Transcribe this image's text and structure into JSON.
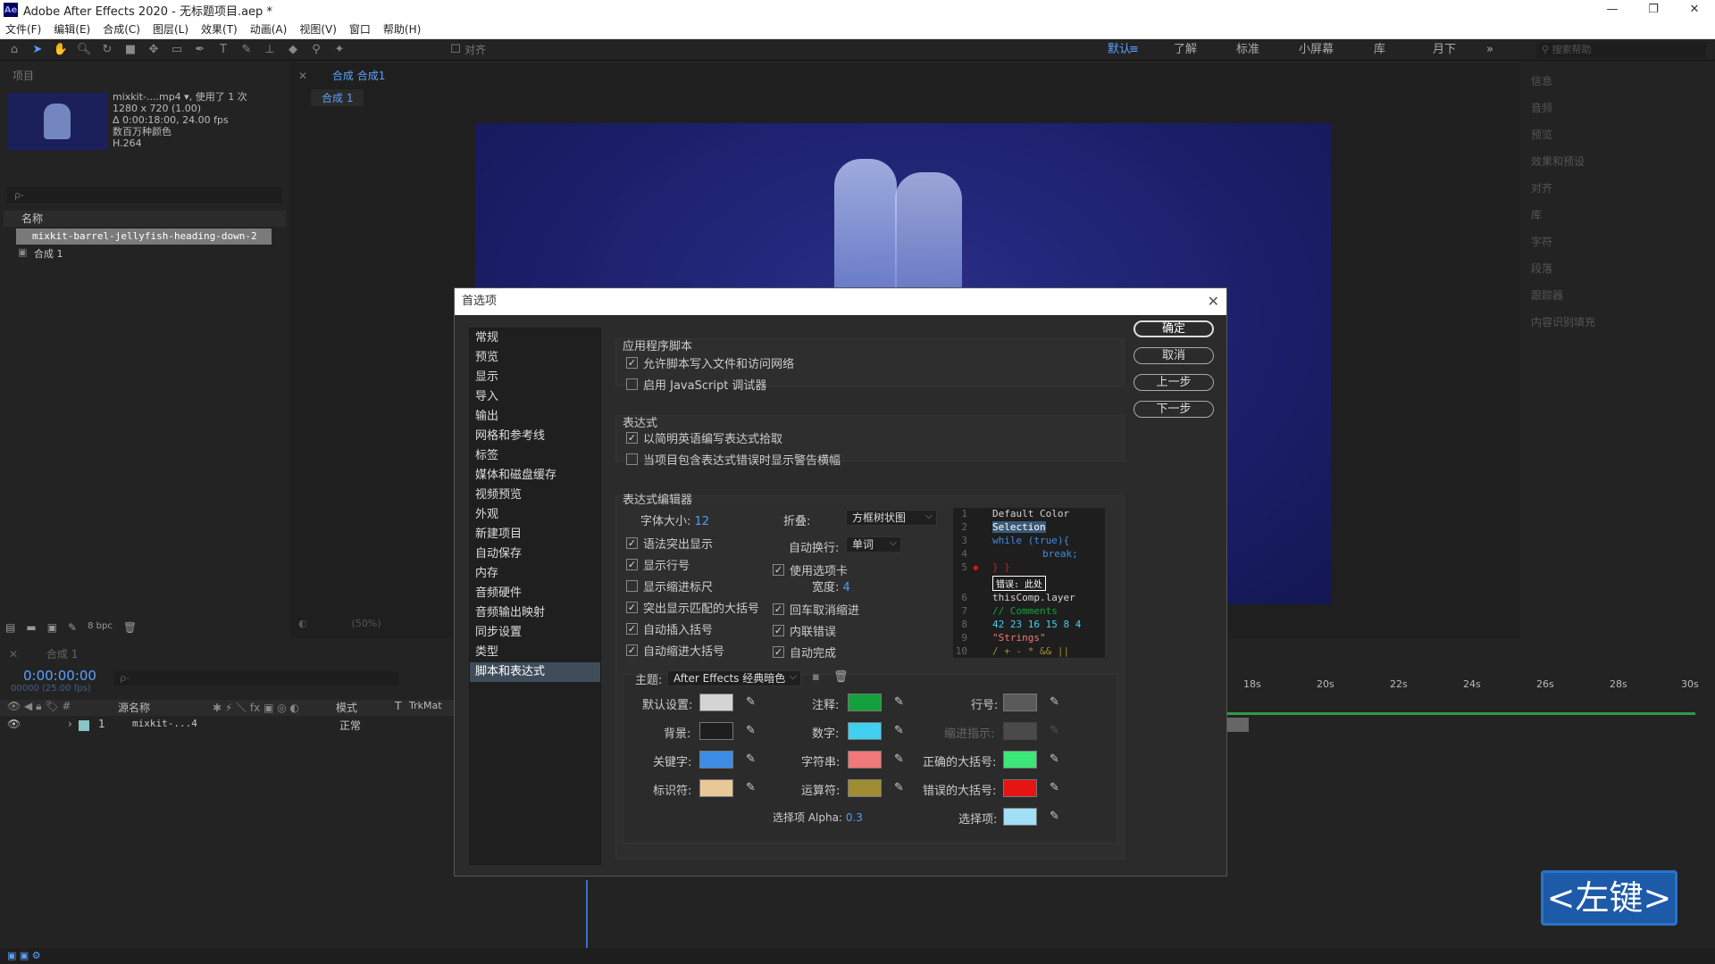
{
  "window": {
    "title": "Adobe After Effects 2020 - 无标题项目.aep *",
    "logo": "Ae",
    "controls": [
      "—",
      "❐",
      "✕"
    ]
  },
  "menu": [
    "文件(F)",
    "编辑(E)",
    "合成(C)",
    "图层(L)",
    "效果(T)",
    "动画(A)",
    "视图(V)",
    "窗口",
    "帮助(H)"
  ],
  "toolbar": {
    "snap_label": "对齐"
  },
  "workspaces": {
    "items": [
      "默认",
      "了解",
      "标准",
      "小屏幕",
      "库",
      "月下"
    ],
    "active": "默认",
    "more": "»",
    "search_placeholder": "搜索帮助"
  },
  "project_panel": {
    "title": "项目",
    "file_name": "mixkit-....mp4 ▾",
    "used": ", 使用了 1 次",
    "resolution": "1280 x 720 (1.00)",
    "duration": "Δ 0:00:18:00, 24.00 fps",
    "colors": "数百万种颜色",
    "codec": "H.264",
    "search_placeholder": "ρ-",
    "col_name": "名称",
    "items": [
      "mixkit-barrel-jellyfish-heading-down-2",
      "合成 1"
    ],
    "bpc": "8 bpc"
  },
  "comp_panel": {
    "tab": "合成 合成1",
    "sub_tab": "合成 1",
    "zoom": "(50%)"
  },
  "right_panel": {
    "items": [
      "信息",
      "音频",
      "预览",
      "效果和预设",
      "对齐",
      "库",
      "字符",
      "段落",
      "跟踪器",
      "内容识别填充"
    ]
  },
  "timeline": {
    "tab": "合成 1",
    "timecode": "0:00:00:00",
    "frame_info": "00000 (25.00 fps)",
    "search_placeholder": "ρ-",
    "col_source": "源名称",
    "col_mode": "模式",
    "col_t": "T",
    "col_trkmat": "TrkMat",
    "layer_num": "1",
    "layer_name": "mixkit-...4",
    "layer_mode": "正常",
    "ruler": [
      "18s",
      "20s",
      "22s",
      "24s",
      "26s",
      "28s",
      "30s"
    ]
  },
  "dialog": {
    "title": "首选项",
    "close": "✕",
    "categories": [
      "常规",
      "预览",
      "显示",
      "导入",
      "输出",
      "网格和参考线",
      "标签",
      "媒体和磁盘缓存",
      "视频预览",
      "外观",
      "新建项目",
      "自动保存",
      "内存",
      "音频硬件",
      "音频输出映射",
      "同步设置",
      "类型",
      "脚本和表达式"
    ],
    "selected_category": "脚本和表达式",
    "buttons": {
      "ok": "确定",
      "cancel": "取消",
      "prev": "上一步",
      "next": "下一步"
    },
    "app_scripts": {
      "title": "应用程序脚本",
      "allow_write": "允许脚本写入文件和访问网络",
      "enable_debugger": "启用 JavaScript 调试器"
    },
    "expressions": {
      "title": "表达式",
      "english_pickwhip": "以简明英语编写表达式拾取",
      "warn_banner": "当项目包含表达式错误时显示警告横幅"
    },
    "editor": {
      "title": "表达式编辑器",
      "font_size_label": "字体大小:",
      "font_size": "12",
      "fold_label": "折叠:",
      "fold_value": "方框树状图",
      "wrap_label": "自动换行:",
      "wrap_value": "单词",
      "syntax_highlight": "语法突出显示",
      "line_numbers": "显示行号",
      "indent_guides": "显示缩进标尺",
      "match_brackets": "突出显示匹配的大括号",
      "auto_close_brackets": "自动插入括号",
      "auto_indent": "自动缩进大括号",
      "use_tabs": "使用选项卡",
      "tab_width_label": "宽度:",
      "tab_width": "4",
      "return_unindent": "回车取消缩进",
      "inline_errors": "内联错误",
      "autocomplete": "自动完成",
      "theme_label": "主题:",
      "theme_value": "After Effects 经典暗色",
      "colors": {
        "default": {
          "label": "默认设置:",
          "hex": "#d4d4d4"
        },
        "background": {
          "label": "背景:",
          "hex": "#1e1e1e"
        },
        "keyword": {
          "label": "关键字:",
          "hex": "#3c8ce6"
        },
        "identifier": {
          "label": "标识符:",
          "hex": "#e8c896"
        },
        "comment": {
          "label": "注释:",
          "hex": "#14a03c"
        },
        "number": {
          "label": "数字:",
          "hex": "#40d0f0"
        },
        "string": {
          "label": "字符串:",
          "hex": "#f07878"
        },
        "operator": {
          "label": "运算符:",
          "hex": "#a08c32"
        },
        "line_number": {
          "label": "行号:",
          "hex": "#5a5a5a"
        },
        "indent_hint": {
          "label": "缩进指示:",
          "hex": "#4a4a4a"
        },
        "correct_bracket": {
          "label": "正确的大括号:",
          "hex": "#3ce678"
        },
        "error_bracket": {
          "label": "错误的大括号:",
          "hex": "#e61414"
        },
        "selection": {
          "label": "选择项:",
          "hex": "#a0e0f5"
        }
      },
      "selection_alpha_label": "选择项 Alpha:",
      "selection_alpha": "0.3",
      "preview": [
        {
          "n": "1",
          "text": "Default Color"
        },
        {
          "n": "2",
          "text": "Selection"
        },
        {
          "n": "3",
          "text": "while (true){"
        },
        {
          "n": "4",
          "text": "  break;"
        },
        {
          "n": "5",
          "text": "} }"
        },
        {
          "n": "",
          "text": "错误: 此处"
        },
        {
          "n": "6",
          "text": "thisComp.layer"
        },
        {
          "n": "7",
          "text": "// Comments"
        },
        {
          "n": "8",
          "text": "42 23 16 15 8 4"
        },
        {
          "n": "9",
          "text": "\"Strings\""
        },
        {
          "n": "10",
          "text": "/ + - * && ||"
        }
      ]
    }
  },
  "hint_overlay": "<左键>"
}
